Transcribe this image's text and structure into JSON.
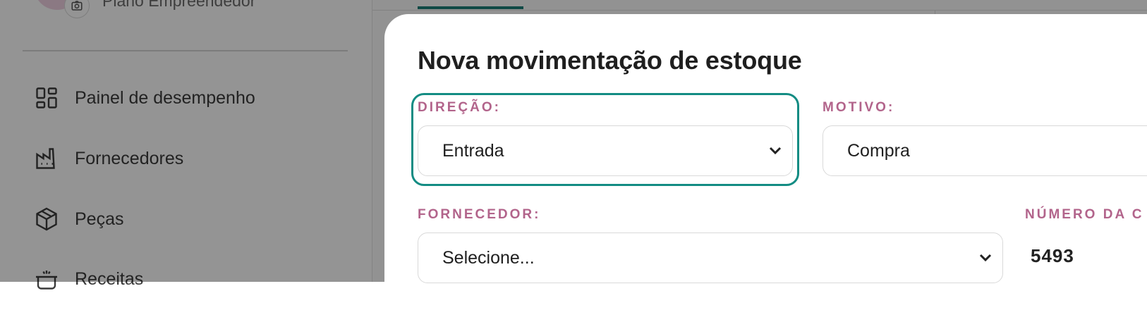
{
  "sidebar": {
    "plan_label": "Plano Empreendedor",
    "items": [
      {
        "icon": "dashboard-icon",
        "label": "Painel de desempenho"
      },
      {
        "icon": "factory-icon",
        "label": "Fornecedores"
      },
      {
        "icon": "package-icon",
        "label": "Peças"
      },
      {
        "icon": "cooking-pot-icon",
        "label": "Receitas"
      }
    ]
  },
  "modal": {
    "title": "Nova movimentação de estoque",
    "direction": {
      "label": "DIREÇÃO:",
      "value": "Entrada"
    },
    "reason": {
      "label": "MOTIVO:",
      "value": "Compra"
    },
    "supplier": {
      "label": "FORNECEDOR:",
      "placeholder": "Selecione..."
    },
    "invoice_number": {
      "label": "NÚMERO DA C",
      "value": "5493"
    }
  },
  "colors": {
    "accent": "#138c83",
    "label": "#b2648b",
    "overlay": "rgba(0,0,0,0.42)"
  }
}
